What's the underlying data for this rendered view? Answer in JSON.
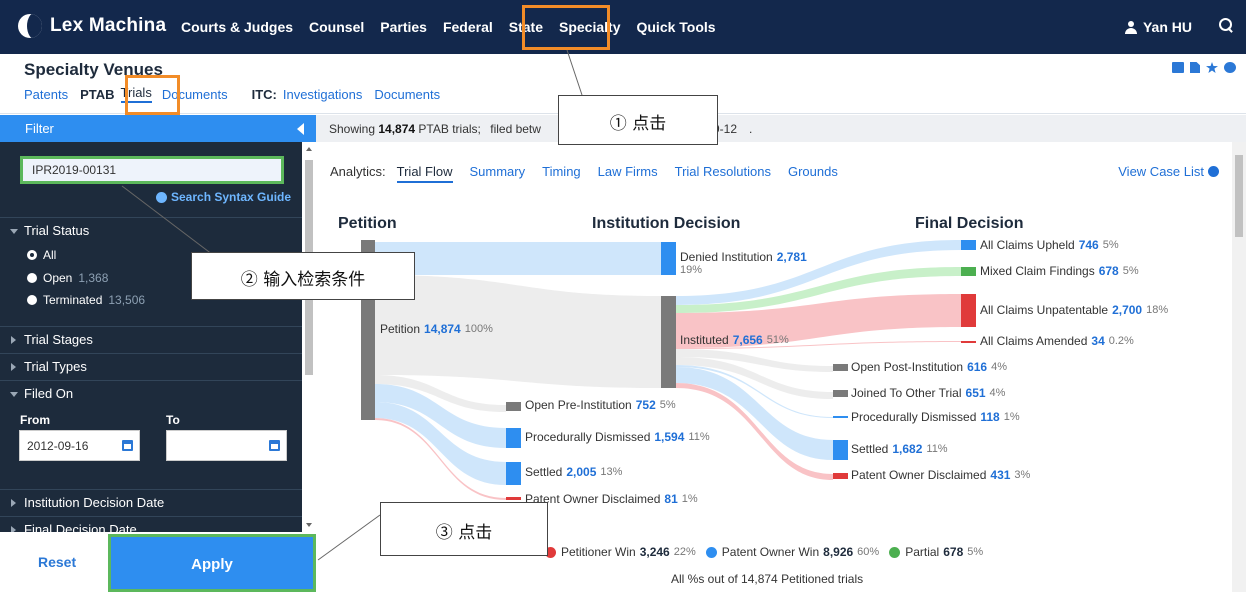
{
  "app": {
    "brand": "Lex Machina"
  },
  "nav": {
    "items": [
      "Courts & Judges",
      "Counsel",
      "Parties",
      "Federal",
      "State",
      "Specialty",
      "Quick Tools"
    ],
    "active": "Specialty",
    "user": "Yan HU"
  },
  "header": {
    "title": "Specialty Venues",
    "links": {
      "patents": "Patents",
      "ptab": "PTAB",
      "trials": "Trials",
      "documents": "Documents",
      "itc": "ITC:",
      "investigations": "Investigations",
      "itc_documents": "Documents"
    }
  },
  "sidebar": {
    "filter_label": "Filter",
    "search_value": "IPR2019-00131",
    "syntax_guide": "Search Syntax Guide",
    "trial_status": {
      "label": "Trial Status",
      "options": [
        {
          "label": "All",
          "count": "",
          "selected": true
        },
        {
          "label": "Open",
          "count": "1,368",
          "selected": false
        },
        {
          "label": "Terminated",
          "count": "13,506",
          "selected": false
        }
      ]
    },
    "sections": {
      "trial_stages": "Trial Stages",
      "trial_types": "Trial Types",
      "filed_on": "Filed On",
      "institution_decision_date": "Institution Decision Date",
      "final_decision_date": "Final Decision Date"
    },
    "filed_on": {
      "from_label": "From",
      "to_label": "To",
      "from_value": "2012-09-16",
      "to_value": ""
    },
    "reset": "Reset",
    "apply": "Apply"
  },
  "showing": {
    "prefix": "Showing",
    "count": "14,874",
    "suffix": "PTAB trials;",
    "filed": "filed betw",
    "date_tail": "9-12",
    "end": "."
  },
  "analytics": {
    "label": "Analytics:",
    "tabs": [
      "Trial Flow",
      "Summary",
      "Timing",
      "Law Firms",
      "Trial Resolutions",
      "Grounds"
    ],
    "active": "Trial Flow",
    "view_case_list": "View Case List"
  },
  "flow": {
    "columns": {
      "petition": "Petition",
      "institution": "Institution Decision",
      "final": "Final Decision"
    },
    "nodes": {
      "petition": {
        "label": "Petition",
        "value": "14,874",
        "pct": "100%"
      },
      "denied": {
        "label": "Denied Institution",
        "value": "2,781",
        "pct": "19%"
      },
      "instituted": {
        "label": "Instituted",
        "value": "7,656",
        "pct": "51%"
      },
      "open_pre": {
        "label": "Open Pre-Institution",
        "value": "752",
        "pct": "5%"
      },
      "proc_dis_pre": {
        "label": "Procedurally Dismissed",
        "value": "1,594",
        "pct": "11%"
      },
      "settled_pre": {
        "label": "Settled",
        "value": "2,005",
        "pct": "13%"
      },
      "po_disclaimed_pre": {
        "label": "Patent Owner Disclaimed",
        "value": "81",
        "pct": "1%"
      },
      "upheld": {
        "label": "All Claims Upheld",
        "value": "746",
        "pct": "5%"
      },
      "mixed": {
        "label": "Mixed Claim Findings",
        "value": "678",
        "pct": "5%"
      },
      "unpatentable": {
        "label": "All Claims Unpatentable",
        "value": "2,700",
        "pct": "18%"
      },
      "amended": {
        "label": "All Claims Amended",
        "value": "34",
        "pct": "0.2%"
      },
      "open_post": {
        "label": "Open Post-Institution",
        "value": "616",
        "pct": "4%"
      },
      "joined": {
        "label": "Joined To Other Trial",
        "value": "651",
        "pct": "4%"
      },
      "proc_dis_post": {
        "label": "Procedurally Dismissed",
        "value": "118",
        "pct": "1%"
      },
      "settled_post": {
        "label": "Settled",
        "value": "1,682",
        "pct": "11%"
      },
      "po_disclaimed_post": {
        "label": "Patent Owner Disclaimed",
        "value": "431",
        "pct": "3%"
      }
    },
    "legend": [
      {
        "label": "Petitioner Win",
        "value": "3,246",
        "pct": "22%"
      },
      {
        "label": "Patent Owner Win",
        "value": "8,926",
        "pct": "60%"
      },
      {
        "label": "Partial",
        "value": "678",
        "pct": "5%"
      }
    ],
    "footnote": "All %s out of 14,874 Petitioned trials"
  },
  "annotations": {
    "step1": "① 点击",
    "step2": "② 输入检索条件",
    "step3": "③ 点击"
  },
  "colors": {
    "nav_bg": "#13284c",
    "accent": "#2e8ef0",
    "highlight_orange": "#f28c28",
    "highlight_green": "#5cb85c",
    "red": "#e03a3a",
    "green_flow": "#9fe2a3",
    "blue_flow": "#b9dcfa",
    "pink_flow": "#f9c3c6"
  }
}
